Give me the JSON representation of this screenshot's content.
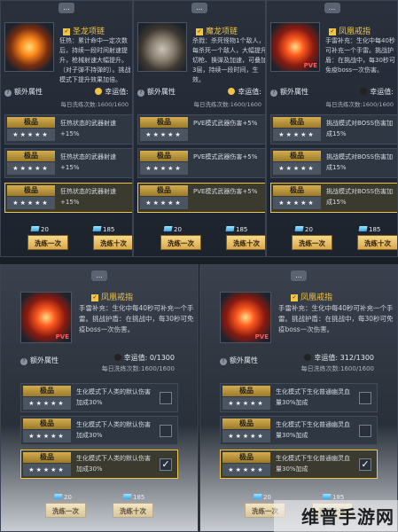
{
  "common": {
    "extra_attr": "额外属性",
    "luck_label": "幸运值:",
    "tier": "极品",
    "stars": "★★★★★",
    "btn_once": "洗练一次",
    "btn_ten": "洗练十次",
    "chat_icon": "...",
    "pve": "PVE"
  },
  "panels": [
    {
      "name": "圣龙项链",
      "desc": "狂热：累计命中一定次数后，持续一段时间射速提升，枪械射速大幅提升。（对子弹不持弹的）。挑战模式下提升效果加倍。",
      "luck": "",
      "daily": "每日洗练次数:1600/1600",
      "rows": [
        "狂热状态的武器射速+15%",
        "狂热状态的武器射速+15%",
        "狂热状态的武器射速+15%"
      ],
      "cost_once": "20",
      "cost_ten": "185"
    },
    {
      "name": "魔龙项链",
      "desc": "杀戮：杀死怪物1个敌人，每杀死一个敌人，大幅提升切枪、换弹及加速，可叠加3层，持续一段时间，生效。",
      "luck": "",
      "daily": "每日洗练次数:1600/1600",
      "rows": [
        "PVE模式武器伤害+5%",
        "PVE模式武器伤害+5%",
        "PVE模式武器伤害+5%"
      ],
      "cost_once": "20",
      "cost_ten": "185"
    },
    {
      "name": "凤凰戒指",
      "desc": "手雷补充：生化中每40秒可补充一个手雷。挑战护盾：在挑战中，每30秒可免疫boss一次伤害。",
      "luck": "",
      "daily": "每日洗练次数:1600/1600",
      "rows": [
        "挑战模式对BOSS伤害加成15%",
        "挑战模式对BOSS伤害加成15%",
        "挑战模式对BOSS伤害加成15%"
      ],
      "cost_once": "20",
      "cost_ten": "185"
    },
    {
      "name": "凤凰戒指",
      "desc": "手雷补充：生化中每40秒可补充一个手雷。挑战护盾：在挑战中，每30秒可免疫boss一次伤害。",
      "luck": "0/1300",
      "daily": "每日洗练次数:1600/1600",
      "rows": [
        "生化模式下人类的默认伤害加成30%",
        "生化模式下人类的默认伤害加成30%",
        "生化模式下人类的默认伤害加成30%"
      ],
      "checks": [
        false,
        false,
        true
      ],
      "cost_once": "20",
      "cost_ten": "185"
    },
    {
      "name": "凤凰戒指",
      "desc": "手雷补充：生化中每40秒可补充一个手雷。挑战护盾：在挑战中，每30秒可免疫boss一次伤害。",
      "luck": "312/1300",
      "daily": "每日洗练次数:1600/1600",
      "rows": [
        "生化模式下生化普通幽灵血量30%加成",
        "生化模式下生化普通幽灵血量30%加成",
        "生化模式下生化普通幽灵血量30%加成"
      ],
      "checks": [
        false,
        false,
        true
      ],
      "cost_once": "20",
      "cost_ten": "185"
    }
  ],
  "watermark": "维普手游网",
  "colors": {
    "gold": "#f0c445",
    "tier_bg": "#c9a146",
    "panel_bg": "#232a34"
  }
}
